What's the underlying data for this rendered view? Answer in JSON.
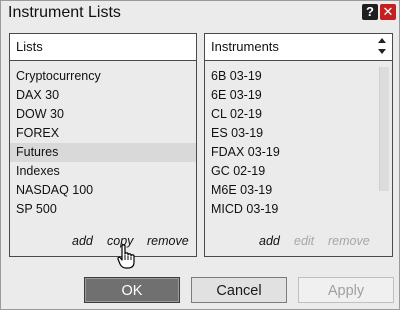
{
  "window": {
    "title": "Instrument Lists"
  },
  "titlebar": {
    "help_glyph": "?",
    "close_glyph": "✕"
  },
  "lists_panel": {
    "header": "Lists",
    "items": [
      "Cryptocurrency",
      "DAX 30",
      "DOW 30",
      "FOREX",
      "Futures",
      "Indexes",
      "NASDAQ 100",
      "SP 500"
    ],
    "selected": "Futures",
    "actions": {
      "add": "add",
      "copy": "copy",
      "remove": "remove"
    }
  },
  "instruments_panel": {
    "header": "Instruments",
    "items": [
      "6B 03-19",
      "6E 03-19",
      "CL 02-19",
      "ES 03-19",
      "FDAX 03-19",
      "GC 02-19",
      "M6E 03-19",
      "MICD 03-19"
    ],
    "actions": {
      "add": "add",
      "edit": "edit",
      "remove": "remove"
    }
  },
  "buttons": {
    "ok": "OK",
    "cancel": "Cancel",
    "apply": "Apply"
  }
}
